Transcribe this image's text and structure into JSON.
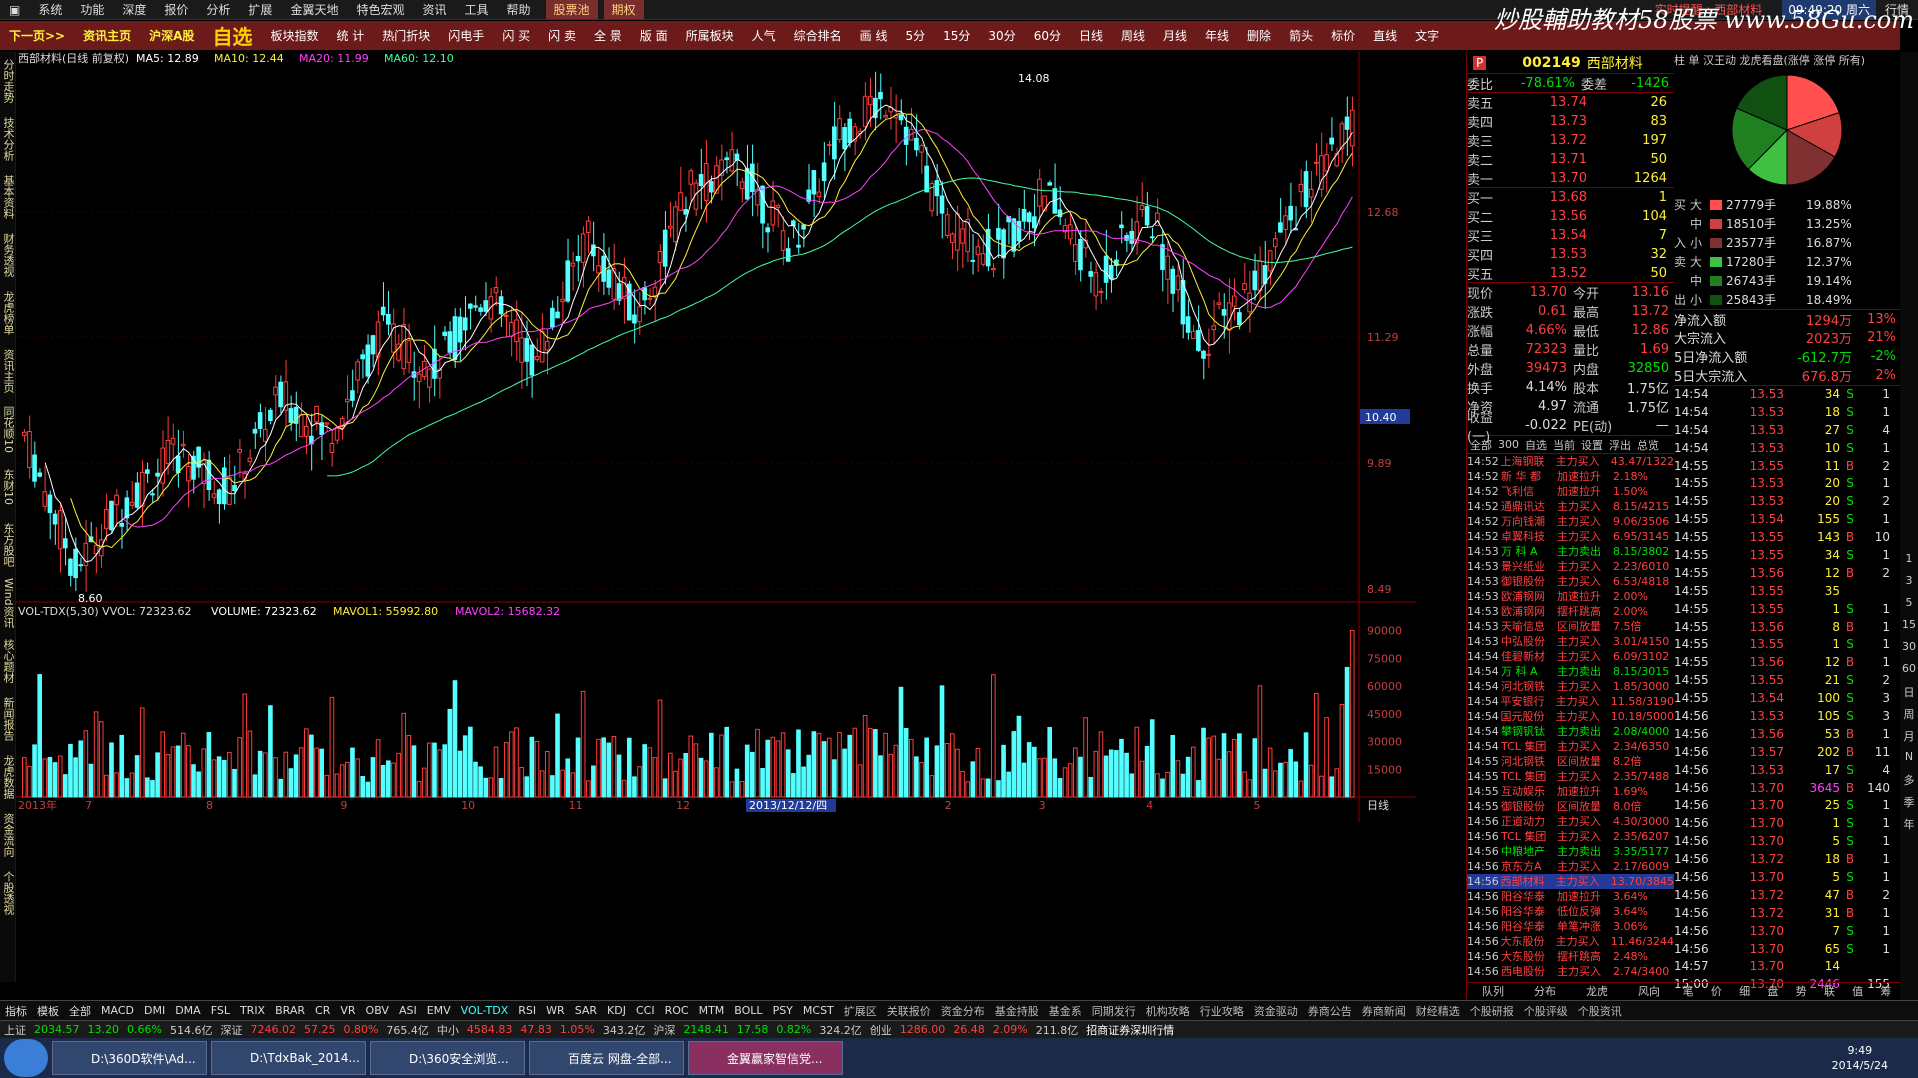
{
  "menu": [
    "系统",
    "功能",
    "深度",
    "报价",
    "分析",
    "扩展",
    "金翼天地",
    "特色宏观",
    "资讯",
    "工具",
    "帮助"
  ],
  "menu_tag1": "股票池",
  "menu_tag2": "期权",
  "menu_hot": "实时提醒 : 西部材料",
  "clock": "09:49:20 周六",
  "menu_tail": "行情",
  "watermark": "炒股輔助教材58股票 www.58Gu.com",
  "toolbar": [
    "下一页>>",
    "资讯主页",
    "沪深A股",
    "自选",
    "板块指数",
    "统 计",
    "热门折块",
    "闪电手",
    "闪 买",
    "闪 卖",
    "全 景",
    "版 面",
    "所属板块",
    "人气",
    "综合排名",
    "画 线",
    "5分",
    "15分",
    "30分",
    "60分",
    "日线",
    "周线",
    "月线",
    "年线",
    "删除",
    "箭头",
    "标价",
    "直线",
    "文字"
  ],
  "leftbar": [
    "分时走势",
    "技术分析",
    "基本资料",
    "财务透视",
    "龙虎榜单",
    "资讯主页",
    "同花顺10",
    "东财10",
    "东方股吧",
    "Wind资讯",
    "核心题材",
    "新闻报告",
    "龙虎数据",
    "资金流向",
    "个股透视"
  ],
  "chart_data": {
    "type": "candlestick",
    "title": "西部材料(日线 前复权)",
    "ma_labels": [
      {
        "t": "MA5: 12.89",
        "c": "#ffffff"
      },
      {
        "t": "MA10: 12.44",
        "c": "#ffef3a"
      },
      {
        "t": "MA20: 11.99",
        "c": "#ff40ff"
      },
      {
        "t": "MA60: 12.10",
        "c": "#40ffa0"
      }
    ],
    "price_ticks": [
      "12.68",
      "11.29",
      "9.89",
      "8.49"
    ],
    "price_tick_values": [
      12.68,
      11.29,
      9.89,
      8.49
    ],
    "ylim": [
      8.4,
      14.3
    ],
    "current_price_tag": "10.40",
    "high_label": "14.08",
    "low_label": "8.60",
    "vol_label": "VOL-TDX(5,30) VVOL: 72323.62",
    "vol_mas": [
      {
        "t": "VOLUME: 72323.62",
        "c": "#ffffff"
      },
      {
        "t": "MAVOL1: 55992.80",
        "c": "#ffef3a"
      },
      {
        "t": "MAVOL2: 15682.32",
        "c": "#ff40ff"
      }
    ],
    "vol_ticks": [
      "90000",
      "75000",
      "60000",
      "45000",
      "30000",
      "15000"
    ],
    "vol_tick_values": [
      90000,
      75000,
      60000,
      45000,
      30000,
      15000
    ],
    "vol_ylim": [
      0,
      100000
    ],
    "x_months": [
      "2013年",
      "7",
      "8",
      "9",
      "10",
      "11",
      "12",
      "1",
      "2",
      "3",
      "4",
      "5"
    ],
    "x_month_pos": [
      0,
      0.05,
      0.14,
      0.24,
      0.33,
      0.41,
      0.49,
      0.59,
      0.69,
      0.76,
      0.84,
      0.92
    ],
    "date_tag": "2013/12/12/四",
    "period": "日线"
  },
  "quote": {
    "code": "002149",
    "name": "西部材料",
    "webi_label": "委比",
    "webi": "-78.61%",
    "weicha_label": "委差",
    "weicha": "-1426",
    "asks": [
      {
        "l": "卖五",
        "p": "13.74",
        "v": "26"
      },
      {
        "l": "卖四",
        "p": "13.73",
        "v": "83"
      },
      {
        "l": "卖三",
        "p": "13.72",
        "v": "197"
      },
      {
        "l": "卖二",
        "p": "13.71",
        "v": "50"
      },
      {
        "l": "卖一",
        "p": "13.70",
        "v": "1264"
      }
    ],
    "bids": [
      {
        "l": "买一",
        "p": "13.68",
        "v": "1"
      },
      {
        "l": "买二",
        "p": "13.56",
        "v": "104"
      },
      {
        "l": "买三",
        "p": "13.54",
        "v": "7"
      },
      {
        "l": "买四",
        "p": "13.53",
        "v": "32"
      },
      {
        "l": "买五",
        "p": "13.52",
        "v": "50"
      }
    ],
    "stats": [
      [
        "现价",
        "13.70",
        "今开",
        "13.16"
      ],
      [
        "涨跌",
        "0.61",
        "最高",
        "13.72"
      ],
      [
        "涨幅",
        "4.66%",
        "最低",
        "12.86"
      ],
      [
        "总量",
        "72323",
        "量比",
        "1.69"
      ],
      [
        "外盘",
        "39473",
        "内盘",
        "32850"
      ],
      [
        "换手",
        "4.14%",
        "股本",
        "1.75亿"
      ],
      [
        "净资",
        "4.97",
        "流通",
        "1.75亿"
      ],
      [
        "收益(一)",
        "-0.022",
        "PE(动)",
        "—"
      ]
    ]
  },
  "tabs": [
    "全部",
    "300",
    "自选",
    "当前",
    "设置",
    "浮出",
    "总览"
  ],
  "news": [
    [
      "14:52",
      "上海钢联",
      "主力买入",
      "43.47/1322"
    ],
    [
      "14:52",
      "新 华 都",
      "加速拉升",
      "2.18%"
    ],
    [
      "14:52",
      "飞利信",
      "加速拉升",
      "1.50%"
    ],
    [
      "14:52",
      "通鼎讯达",
      "主力买入",
      "8.15/4215"
    ],
    [
      "14:52",
      "万向钱潮",
      "主力买入",
      "9.06/3506"
    ],
    [
      "14:52",
      "卓翼科技",
      "主力买入",
      "6.95/3145"
    ],
    [
      "14:53",
      "万 科 A",
      "主力卖出",
      "8.15/3802"
    ],
    [
      "14:53",
      "景兴纸业",
      "主力买入",
      "2.23/6010"
    ],
    [
      "14:53",
      "御银股份",
      "主力买入",
      "6.53/4818"
    ],
    [
      "14:53",
      "欧浦钢网",
      "加速拉升",
      "2.00%"
    ],
    [
      "14:53",
      "欧浦钢网",
      "摆杆跳高",
      "2.00%"
    ],
    [
      "14:53",
      "天喻信息",
      "区间放量",
      "7.5倍"
    ],
    [
      "14:53",
      "中弘股份",
      "主力买入",
      "3.01/4150"
    ],
    [
      "14:54",
      "佳碧新材",
      "主力买入",
      "6.09/3102"
    ],
    [
      "14:54",
      "万 科 A",
      "主力卖出",
      "8.15/3015"
    ],
    [
      "14:54",
      "河北钢铁",
      "主力买入",
      "1.85/3000"
    ],
    [
      "14:54",
      "平安银行",
      "主力买入",
      "11.58/3190"
    ],
    [
      "14:54",
      "国元股份",
      "主力买入",
      "10.18/5000"
    ],
    [
      "14:54",
      "攀钢钒钛",
      "主力卖出",
      "2.08/4000"
    ],
    [
      "14:54",
      "TCL 集团",
      "主力买入",
      "2.34/6350"
    ],
    [
      "14:55",
      "河北钢铁",
      "区间放量",
      "8.2倍"
    ],
    [
      "14:55",
      "TCL 集团",
      "主力买入",
      "2.35/7488"
    ],
    [
      "14:55",
      "互动娱乐",
      "加速拉升",
      "1.69%"
    ],
    [
      "14:55",
      "御银股份",
      "区间放量",
      "8.0倍"
    ],
    [
      "14:56",
      "正道动力",
      "主力买入",
      "4.30/3000"
    ],
    [
      "14:56",
      "TCL 集团",
      "主力买入",
      "2.35/6207"
    ],
    [
      "14:56",
      "中粮地产",
      "主力卖出",
      "3.35/5177"
    ],
    [
      "14:56",
      "京东方A",
      "主力买入",
      "2.17/6009"
    ],
    [
      "14:56",
      "西部材料",
      "主力买入",
      "13.70/3845"
    ],
    [
      "14:56",
      "阳谷华泰",
      "加速拉升",
      "3.64%"
    ],
    [
      "14:56",
      "阳谷华泰",
      "低位反弹",
      "3.64%"
    ],
    [
      "14:56",
      "阳谷华泰",
      "单笔冲涨",
      "3.06%"
    ],
    [
      "14:56",
      "大东股份",
      "主力买入",
      "11.46/3244"
    ],
    [
      "14:56",
      "大东股份",
      "摆杆跳高",
      "2.48%"
    ],
    [
      "14:56",
      "西电股份",
      "主力买入",
      "2.74/3400"
    ]
  ],
  "far": {
    "header": "柱 单 汉王动 龙虎看盘(涨停 涨停 所有)",
    "legend": [
      [
        "买",
        "大",
        "27779手",
        "19.88%",
        "#ff5050"
      ],
      [
        "",
        "中",
        "18510手",
        "13.25%",
        "#d04040"
      ],
      [
        "入",
        "小",
        "23577手",
        "16.87%",
        "#803030"
      ],
      [
        "卖",
        "大",
        "17280手",
        "12.37%",
        "#40c040"
      ],
      [
        "",
        "中",
        "26743手",
        "19.14%",
        "#208020"
      ],
      [
        "出",
        "小",
        "25843手",
        "18.49%",
        "#105010"
      ]
    ],
    "pie": [
      19.88,
      13.25,
      16.87,
      12.37,
      19.14,
      18.49
    ],
    "flows": [
      [
        "净流入额",
        "1294万",
        "13%"
      ],
      [
        "大宗流入",
        "2023万",
        "21%"
      ],
      [
        "5日净流入额",
        "-612.7万",
        "-2%"
      ],
      [
        "5日大宗流入",
        "676.8万",
        "2%"
      ]
    ],
    "ticks": [
      [
        "14:54",
        "13.53",
        "34",
        "S",
        "1"
      ],
      [
        "14:54",
        "13.53",
        "18",
        "S",
        "1"
      ],
      [
        "14:54",
        "13.53",
        "27",
        "S",
        "4"
      ],
      [
        "14:54",
        "13.53",
        "10",
        "S",
        "1"
      ],
      [
        "14:55",
        "13.55",
        "11",
        "B",
        "2"
      ],
      [
        "14:55",
        "13.53",
        "20",
        "S",
        "1"
      ],
      [
        "14:55",
        "13.53",
        "20",
        "S",
        "2"
      ],
      [
        "14:55",
        "13.54",
        "155",
        "S",
        "1"
      ],
      [
        "14:55",
        "13.55",
        "143",
        "B",
        "10"
      ],
      [
        "14:55",
        "13.55",
        "34",
        "S",
        "1"
      ],
      [
        "14:55",
        "13.56",
        "12",
        "B",
        "2"
      ],
      [
        "14:55",
        "13.55",
        "35",
        "",
        ""
      ],
      [
        "14:55",
        "13.55",
        "1",
        "S",
        "1"
      ],
      [
        "14:55",
        "13.56",
        "8",
        "B",
        "1"
      ],
      [
        "14:55",
        "13.55",
        "1",
        "S",
        "1"
      ],
      [
        "14:55",
        "13.56",
        "12",
        "B",
        "1"
      ],
      [
        "14:55",
        "13.55",
        "21",
        "S",
        "2"
      ],
      [
        "14:55",
        "13.54",
        "100",
        "S",
        "3"
      ],
      [
        "14:56",
        "13.53",
        "105",
        "S",
        "3"
      ],
      [
        "14:56",
        "13.56",
        "53",
        "B",
        "1"
      ],
      [
        "14:56",
        "13.57",
        "202",
        "B",
        "11"
      ],
      [
        "14:56",
        "13.53",
        "17",
        "S",
        "4"
      ],
      [
        "14:56",
        "13.70",
        "3645",
        "B",
        "140"
      ],
      [
        "14:56",
        "13.70",
        "25",
        "S",
        "1"
      ],
      [
        "14:56",
        "13.70",
        "1",
        "S",
        "1"
      ],
      [
        "14:56",
        "13.70",
        "5",
        "S",
        "1"
      ],
      [
        "14:56",
        "13.72",
        "18",
        "B",
        "1"
      ],
      [
        "14:56",
        "13.70",
        "5",
        "S",
        "1"
      ],
      [
        "14:56",
        "13.72",
        "47",
        "B",
        "2"
      ],
      [
        "14:56",
        "13.72",
        "31",
        "B",
        "1"
      ],
      [
        "14:56",
        "13.70",
        "7",
        "S",
        "1"
      ],
      [
        "14:56",
        "13.70",
        "65",
        "S",
        "1"
      ],
      [
        "14:57",
        "13.70",
        "14",
        "",
        ""
      ],
      [
        "15:00",
        "13.70",
        "2446",
        "",
        "155"
      ]
    ],
    "tabs_bottom": [
      "笔",
      "价",
      "细",
      "盘",
      "势",
      "联",
      "值",
      "筹"
    ]
  },
  "rightstrip": [
    "1",
    "3",
    "5",
    "15",
    "30",
    "60",
    "日",
    "周",
    "月",
    "N",
    "多",
    "季",
    "年"
  ],
  "qtabs": [
    "队列",
    "分布",
    "龙虎",
    "风向"
  ],
  "indicators": [
    "指标",
    "模板",
    "全部",
    "MACD",
    "DMI",
    "DMA",
    "FSL",
    "TRIX",
    "BRAR",
    "CR",
    "VR",
    "OBV",
    "ASI",
    "EMV",
    "VOL-TDX",
    "RSI",
    "WR",
    "SAR",
    "KDJ",
    "CCI",
    "ROC",
    "MTM",
    "BOLL",
    "PSY",
    "MCST"
  ],
  "bottom_tabs": [
    "扩展区",
    "关联报价",
    "资金分布",
    "基金持股",
    "基金系",
    "同期发行",
    "机构攻略",
    "行业攻略",
    "资金驱动",
    "券商公告",
    "券商新闻",
    "财经精选",
    "个股研报",
    "个股评级",
    "个股资讯"
  ],
  "status": [
    [
      "上证",
      "#ccc"
    ],
    [
      "2034.57",
      "#00e000"
    ],
    [
      "13.20",
      "#00e000"
    ],
    [
      "0.66%",
      "#00e000"
    ],
    [
      "514.6亿",
      "#ccc"
    ],
    [
      "深证",
      "#ccc"
    ],
    [
      "7246.02",
      "#ff4040"
    ],
    [
      "57.25",
      "#ff4040"
    ],
    [
      "0.80%",
      "#ff4040"
    ],
    [
      "765.4亿",
      "#ccc"
    ],
    [
      "中小",
      "#ccc"
    ],
    [
      "4584.83",
      "#ff4040"
    ],
    [
      "47.83",
      "#ff4040"
    ],
    [
      "1.05%",
      "#ff4040"
    ],
    [
      "343.2亿",
      "#ccc"
    ],
    [
      "沪深",
      "#ccc"
    ],
    [
      "2148.41",
      "#00e000"
    ],
    [
      "17.58",
      "#00e000"
    ],
    [
      "0.82%",
      "#00e000"
    ],
    [
      "324.2亿",
      "#ccc"
    ],
    [
      "创业",
      "#ccc"
    ],
    [
      "1286.00",
      "#ff4040"
    ],
    [
      "26.48",
      "#ff4040"
    ],
    [
      "2.09%",
      "#ff4040"
    ],
    [
      "211.8亿",
      "#ccc"
    ],
    [
      "招商证券深圳行情",
      "#fff"
    ]
  ],
  "tasks": [
    "D:\\360D软件\\Ad...",
    "D:\\TdxBak_2014...",
    "D:\\360安全浏览...",
    "百度云 网盘-全部...",
    "金翼赢家智信党..."
  ],
  "tray_time": "9:49",
  "tray_date": "2014/5/24"
}
